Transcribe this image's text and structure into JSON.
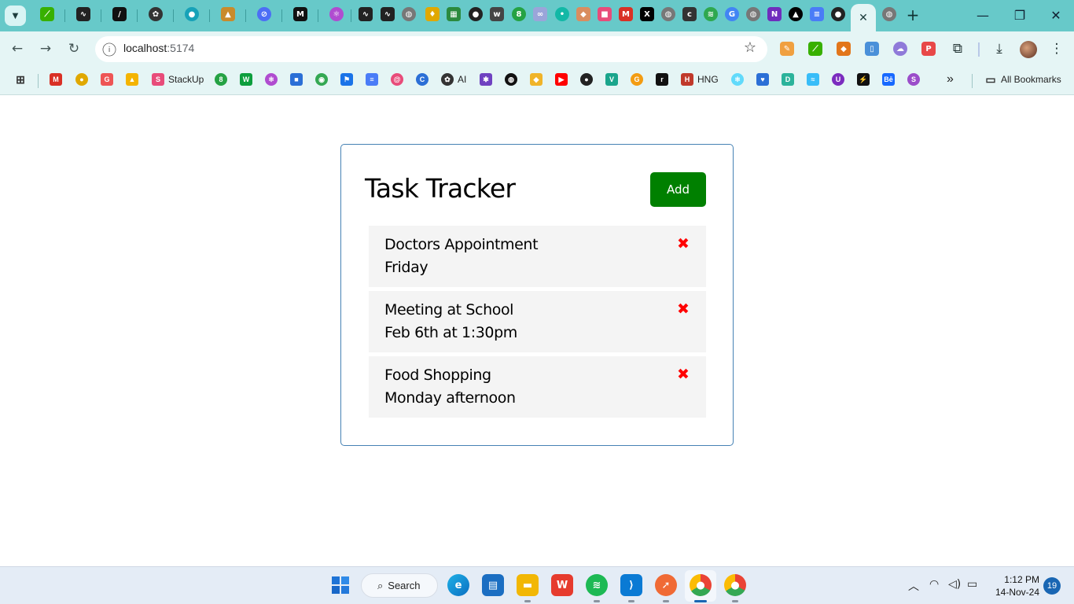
{
  "browser": {
    "active_tab_close": "✕",
    "new_tab": "+",
    "window_controls": {
      "minimize": "—",
      "restore": "❐",
      "close": "✕"
    },
    "address": {
      "host": "localhost",
      "port": ":5174"
    },
    "nav": {
      "back": "←",
      "forward": "→",
      "reload": "↻"
    },
    "star": "☆",
    "bookmarks": {
      "items": [
        {
          "label": "StackUp",
          "icon": "stackup-icon",
          "color": "#e84c7a"
        },
        {
          "label": "AI",
          "icon": "openai-icon",
          "color": "#333333"
        },
        {
          "label": "HNG",
          "icon": "hng-icon",
          "color": "#c0392b"
        }
      ],
      "overflow": "»",
      "all_bookmarks": "All Bookmarks"
    }
  },
  "app": {
    "title": "Task Tracker",
    "add_button": "Add",
    "tasks": [
      {
        "text": "Doctors Appointment",
        "day": "Friday"
      },
      {
        "text": "Meeting at School",
        "day": "Feb 6th at 1:30pm"
      },
      {
        "text": "Food Shopping",
        "day": "Monday afternoon"
      }
    ],
    "delete_glyph": "✖",
    "colors": {
      "add_button": "#008000",
      "task_bg": "#f4f4f4",
      "delete": "#ff0000",
      "card_border": "#4682b4"
    }
  },
  "taskbar": {
    "search_label": "Search",
    "time": "1:12 PM",
    "date": "14-Nov-24",
    "notifications": "19"
  }
}
